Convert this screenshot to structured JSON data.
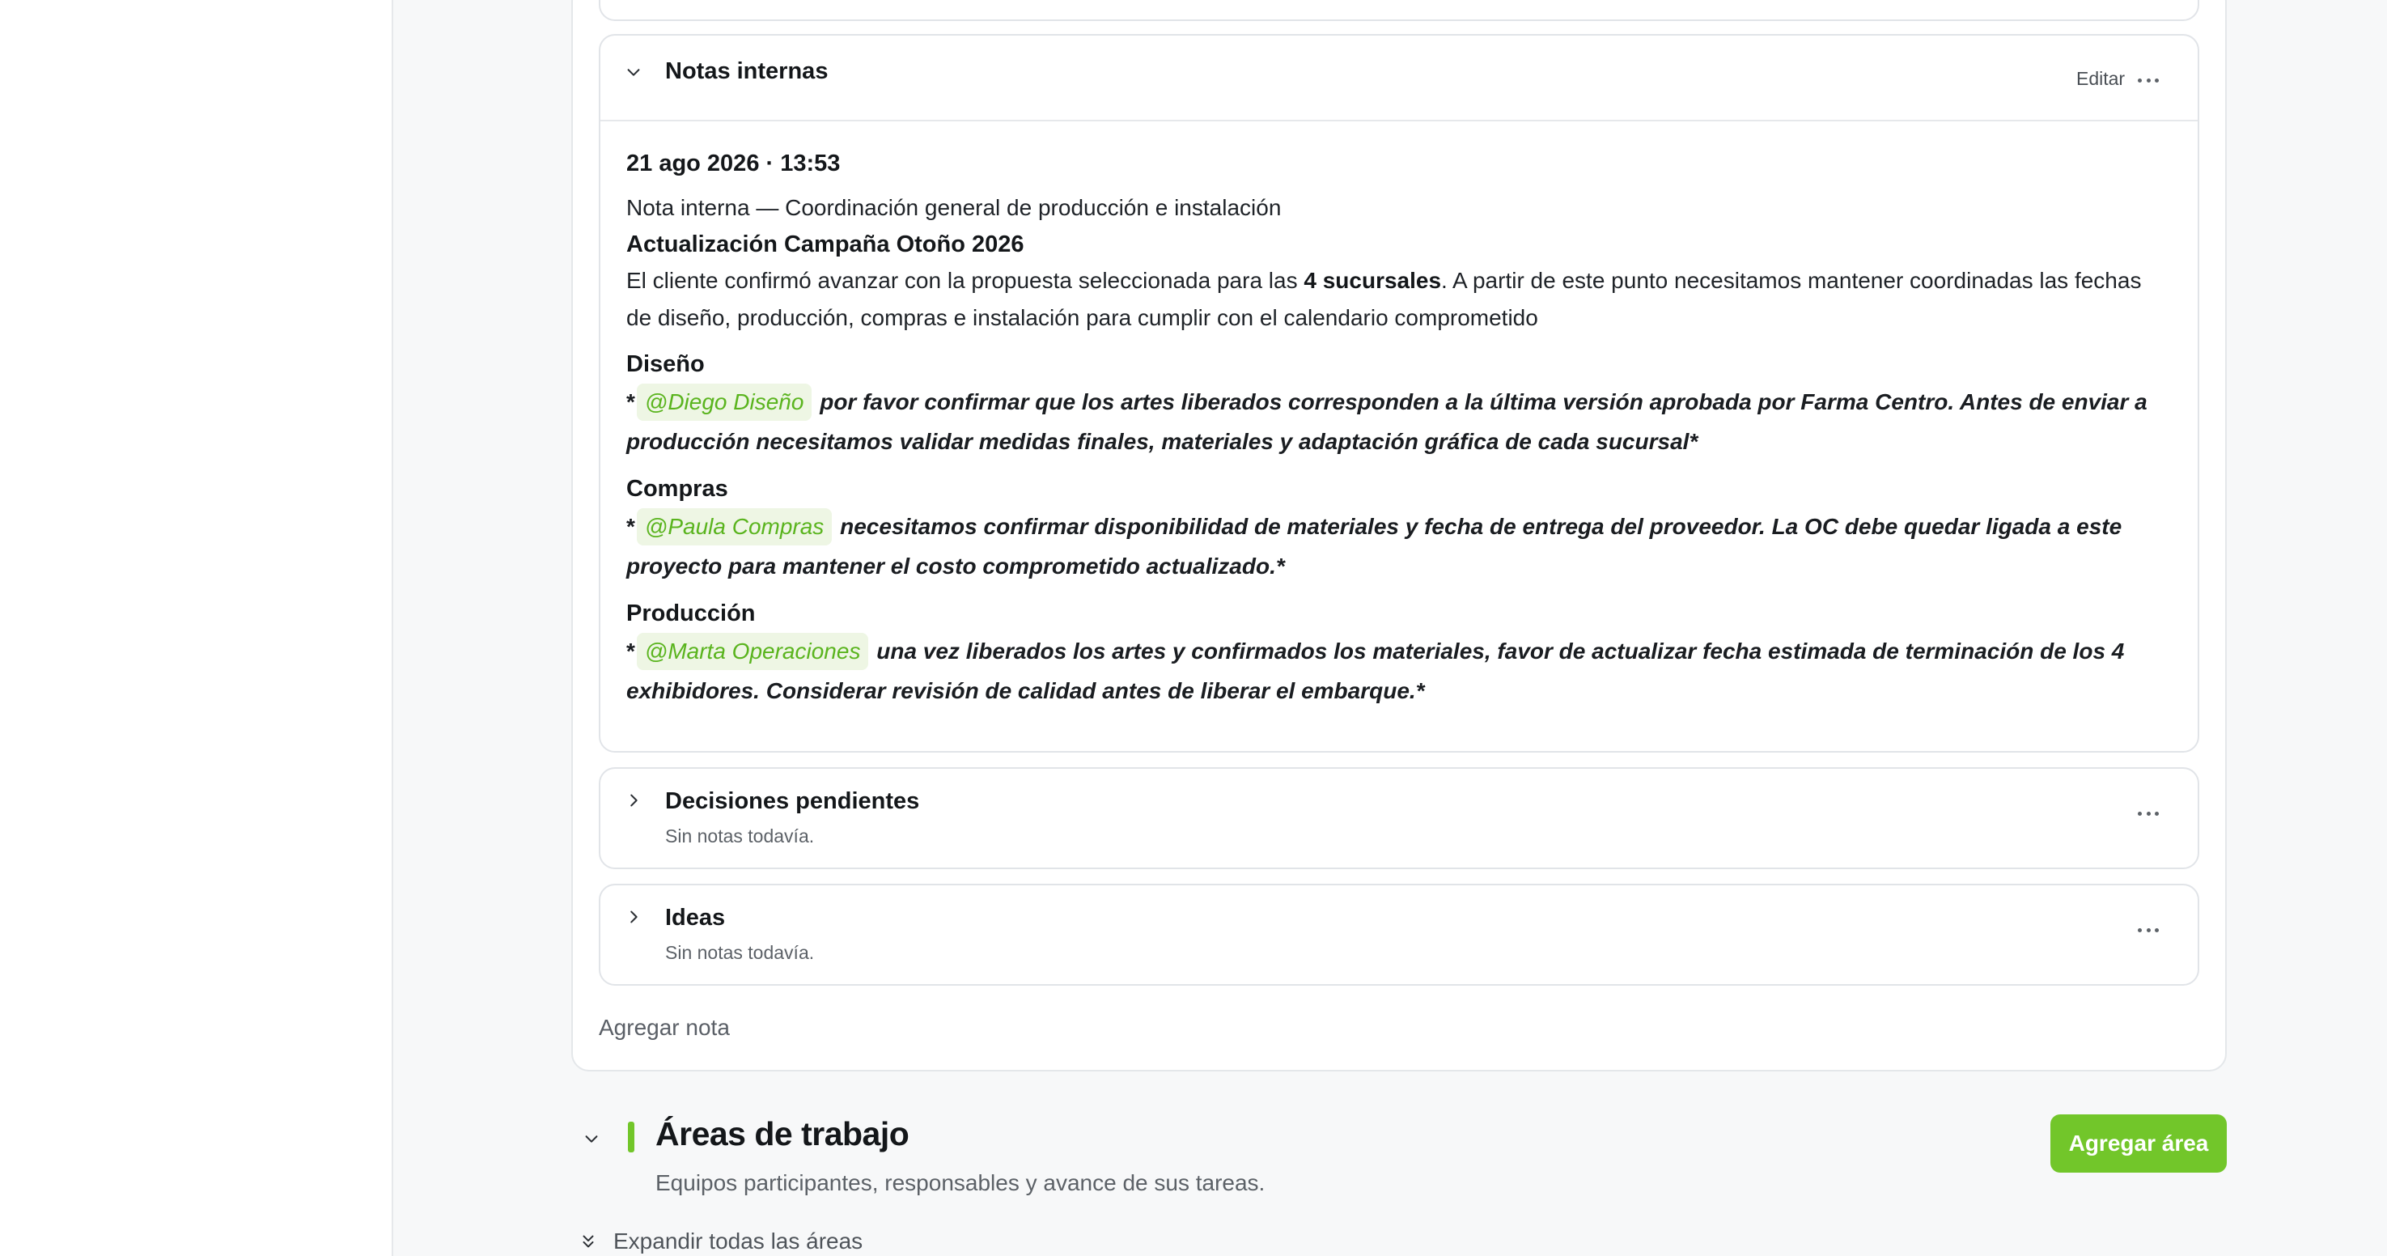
{
  "notes_section": {
    "internal_notes": {
      "title": "Notas internas",
      "edit_label": "Editar",
      "note": {
        "timestamp": "21 ago 2026 · 13:53",
        "heading": "Nota interna — Coordinación general de producción e instalación",
        "subtitle": "Actualización Campaña Otoño 2026",
        "intro_before_bold": "El cliente confirmó avanzar con la propuesta seleccionada para las ",
        "intro_bold": "4 sucursales",
        "intro_after_bold": ". A partir de este punto necesitamos mantener coordinadas las fechas de diseño, producción, compras e instalación para cumplir con el calendario comprometido",
        "sections": [
          {
            "heading": "Diseño",
            "bullet": "*",
            "mention": "@Diego Diseño",
            "text": " por favor confirmar que los artes liberados corresponden a la última versión aprobada por Farma Centro. Antes de enviar a producción necesitamos validar medidas finales, materiales y adaptación gráfica de cada sucursal*"
          },
          {
            "heading": "Compras",
            "bullet": "*",
            "mention": "@Paula Compras",
            "text": " necesitamos confirmar disponibilidad de materiales y fecha de entrega del proveedor. La OC debe quedar ligada a este proyecto para mantener el costo comprometido actualizado.*"
          },
          {
            "heading": "Producción",
            "bullet": "*",
            "mention": "@Marta Operaciones",
            "text": " una vez liberados los artes y confirmados los materiales, favor de actualizar fecha estimada de terminación de los 4 exhibidores. Considerar revisión de calidad antes de liberar el embarque.*"
          }
        ]
      }
    },
    "pending_decisions": {
      "title": "Decisiones pendientes",
      "empty_text": "Sin notas todavía."
    },
    "ideas": {
      "title": "Ideas",
      "empty_text": "Sin notas todavía."
    },
    "add_note_label": "Agregar nota"
  },
  "work_areas": {
    "title": "Áreas de trabajo",
    "description": "Equipos participantes, responsables y avance de sus tareas.",
    "add_button_label": "Agregar área",
    "expand_all_label": "Expandir todas las áreas"
  },
  "colors": {
    "accent": "#72c62a",
    "mention_text": "#5ab41e",
    "mention_bg": "#eef6e4"
  },
  "icons": {
    "collapse": "chevron-down-icon",
    "expand": "chevron-right-icon",
    "more": "more-horizontal-icon",
    "expand_all": "chevrons-down-icon"
  }
}
